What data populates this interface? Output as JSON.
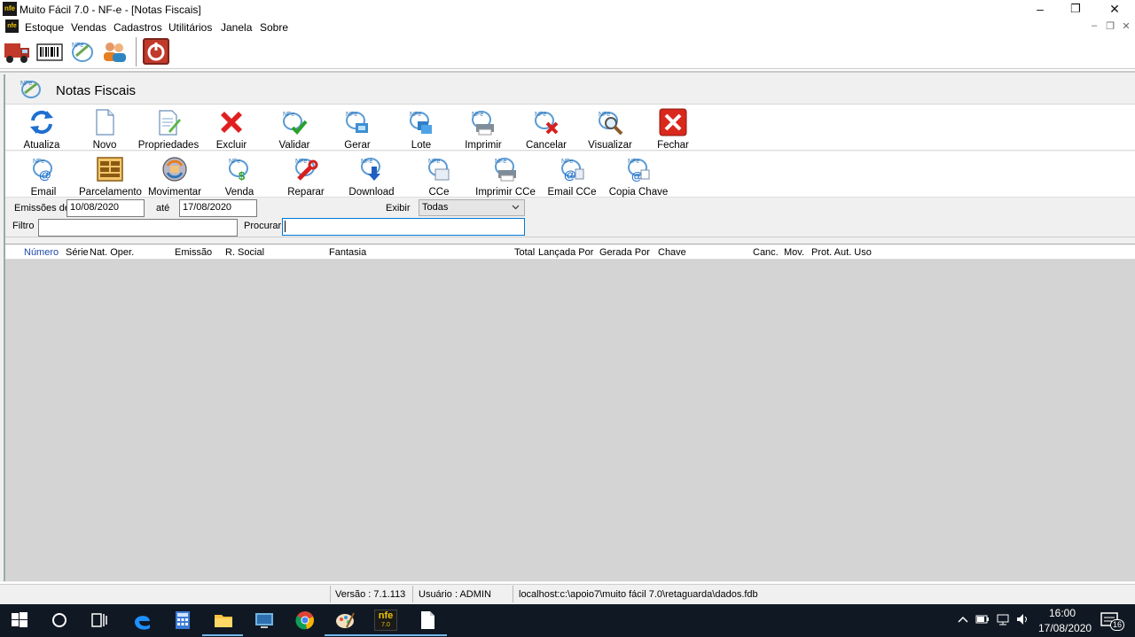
{
  "window": {
    "title": "Muito Fácil 7.0 - NF-e - [Notas Fiscais]",
    "app_icon_text": "nfe",
    "minimize": "–",
    "restore": "❐",
    "close": "✕"
  },
  "menu": {
    "items": [
      "Estoque",
      "Vendas",
      "Cadastros",
      "Utilitários",
      "Janela",
      "Sobre"
    ],
    "mdi_minimize": "–",
    "mdi_restore": "❐",
    "mdi_close": "✕"
  },
  "child": {
    "title": "Notas Fiscais"
  },
  "actions_row1": [
    {
      "label": "Atualiza",
      "icon": "refresh-icon"
    },
    {
      "label": "Novo",
      "icon": "new-document-icon"
    },
    {
      "label": "Propriedades",
      "icon": "properties-icon"
    },
    {
      "label": "Excluir",
      "icon": "delete-icon"
    },
    {
      "label": "Validar",
      "icon": "validate-icon"
    },
    {
      "label": "Gerar",
      "icon": "generate-icon"
    },
    {
      "label": "Lote",
      "icon": "batch-icon"
    },
    {
      "label": "Imprimir",
      "icon": "print-icon"
    },
    {
      "label": "Cancelar",
      "icon": "cancel-icon"
    },
    {
      "label": "Visualizar",
      "icon": "view-icon"
    },
    {
      "label": "Fechar",
      "icon": "close-icon"
    }
  ],
  "actions_row2": [
    {
      "label": "Email",
      "icon": "email-icon"
    },
    {
      "label": "Parcelamento",
      "icon": "installment-icon"
    },
    {
      "label": "Movimentar",
      "icon": "move-icon"
    },
    {
      "label": "Venda",
      "icon": "sale-icon"
    },
    {
      "label": "Reparar",
      "icon": "repair-icon"
    },
    {
      "label": "Download",
      "icon": "download-icon"
    },
    {
      "label": "CCe",
      "icon": "cce-icon"
    },
    {
      "label": "Imprimir CCe",
      "icon": "print-cce-icon"
    },
    {
      "label": "Email CCe",
      "icon": "email-cce-icon"
    },
    {
      "label": "Copia Chave",
      "icon": "copy-key-icon"
    }
  ],
  "filters": {
    "emissoes_label": "Emissões de",
    "date_from": "10/08/2020",
    "ate_label": "até",
    "date_to": "17/08/2020",
    "exibir_label": "Exibir",
    "exibir_value": "Todas",
    "filtro_label": "Filtro",
    "filtro_value": "",
    "procurar_label": "Procurar",
    "procurar_value": ""
  },
  "grid": {
    "columns": [
      "Número",
      "Série",
      "Nat. Oper.",
      "Emissão",
      "R. Social",
      "Fantasia",
      "Total",
      "Lançada Por",
      "Gerada Por",
      "Chave",
      "Canc.",
      "Mov.",
      "Prot. Aut. Uso"
    ]
  },
  "status": {
    "versao": "Versão : 7.1.113",
    "usuario": "Usuário : ADMIN",
    "db": "localhost:c:\\apoio7\\muito fácil 7.0\\retaguarda\\dados.fdb"
  },
  "taskbar": {
    "time": "16:00",
    "date": "17/08/2020",
    "notifications": "16",
    "nfe_label": "nfe",
    "nfe_version": "7.0"
  },
  "colors": {
    "accent": "#0078d7",
    "grid_bg": "#d4d4d4",
    "taskbar": "#101923"
  }
}
